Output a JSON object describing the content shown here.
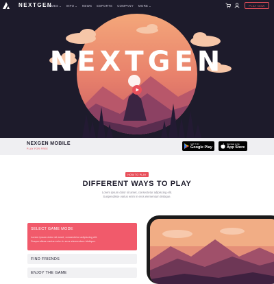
{
  "nav": {
    "brand": "NEXTGEN",
    "menu": [
      "GAMES",
      "INFO",
      "NEWS",
      "ESPORTS",
      "COMPANY",
      "MORE"
    ],
    "dropdown_caret": "⌄",
    "play_label": "PLAY NOW"
  },
  "hero": {
    "title": "NEXTGEN"
  },
  "strip": {
    "title": "NEXGEN MOBILE",
    "subtitle": "PLAY FOR FREE",
    "google": {
      "small": "GET IT ON",
      "large": "Google Play"
    },
    "apple": {
      "small": "Download on the",
      "large": "App Store"
    }
  },
  "how": {
    "tag": "HOW TO PLAY",
    "title": "DIFFERENT WAYS TO PLAY",
    "desc_1": "Lorem ipsum dolor sit amet, consectetur adipiscing elit.",
    "desc_2": "Suspendisse varius enim in eros elementum tristique."
  },
  "cards": {
    "active": {
      "title": "SELECT GAME MODE",
      "desc_1": "Lorem ipsum dolor sit amet, consectetur adipiscing elit.",
      "desc_2": "Suspendisse varius enim in eros elementum tristique."
    },
    "friends": "FIND FRIENDS",
    "enjoy": "ENJOY THE GAME"
  },
  "colors": {
    "dark": "#1d1b2b",
    "accent": "#e8505b",
    "sun": "#f08a6a"
  },
  "icons": [
    "logo-icon",
    "cart-icon",
    "user-icon",
    "play-icon",
    "google-play-icon",
    "apple-icon"
  ]
}
